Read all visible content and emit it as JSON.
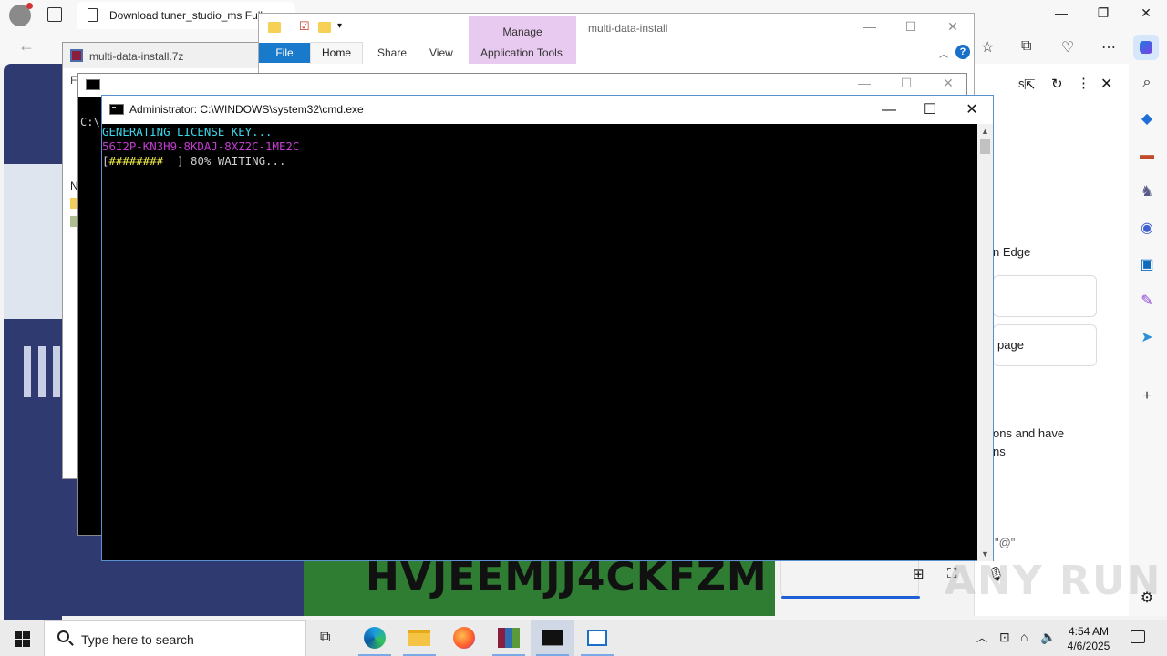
{
  "browser": {
    "tab_title": "Download tuner_studio_ms Full",
    "side_panel": {
      "text_edge": "n Edge",
      "text_page": "page",
      "text_ons_1": "ons and have",
      "text_ons_2": "ns",
      "text_at": "\"@\"",
      "text_s": "s"
    },
    "captcha_text": "HVJEEMJJ4CKFZM"
  },
  "winrar": {
    "title": "multi-data-install.7z",
    "menu_first": "Fi",
    "list_header": "N"
  },
  "explorer": {
    "title": "multi-data-install",
    "manage_label": "Manage",
    "tabs": {
      "file": "File",
      "home": "Home",
      "share": "Share",
      "view": "View",
      "app_tools": "Application Tools"
    }
  },
  "cmd_back": {
    "prompt": "C:\\"
  },
  "cmd": {
    "title": "Administrator: C:\\WINDOWS\\system32\\cmd.exe",
    "lines": {
      "l1": "GENERATING LICENSE KEY...",
      "l2": "56I2P-KN3H9-8KDAJ-8XZ2C-1ME2C",
      "l3_open": "[",
      "l3_bar": "########",
      "l3_rest": "  ] 80% WAITING..."
    },
    "progress_percent": 80
  },
  "taskbar": {
    "search_placeholder": "Type here to search",
    "time": "4:54 AM",
    "date": "4/6/2025"
  },
  "watermark": "ANY RUN",
  "colors": {
    "console_cyan": "#3ad6e9",
    "console_magenta": "#c33bd0",
    "console_yellow": "#f2ef4b",
    "explorer_file_tab": "#1979ca",
    "manage_tab": "#e8c9f0",
    "captcha_bg": "#2e7d32"
  }
}
